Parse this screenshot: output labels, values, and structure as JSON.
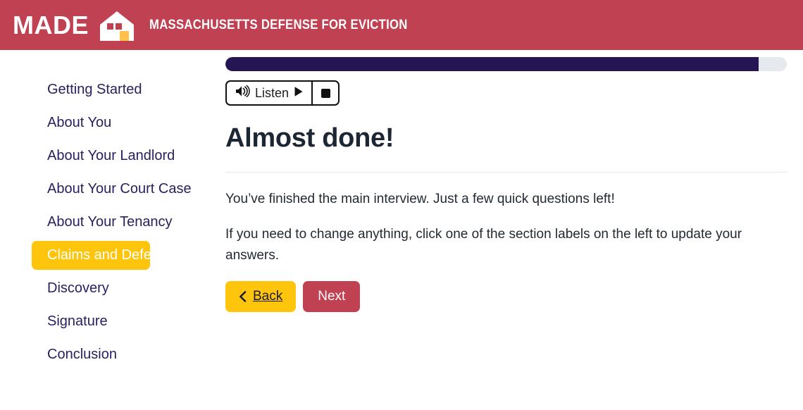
{
  "header": {
    "brand": "MADE",
    "tagline": "MASSACHUSETTS DEFENSE FOR EVICTION",
    "logo_icon": "house-icon",
    "bg_color": "#bf4152"
  },
  "sidebar": {
    "items": [
      {
        "label": "Getting Started",
        "active": false
      },
      {
        "label": "About You",
        "active": false
      },
      {
        "label": "About Your Landlord",
        "active": false
      },
      {
        "label": "About Your Court Case",
        "active": false
      },
      {
        "label": "About Your Tenancy",
        "active": false
      },
      {
        "label": "Claims and Defenses",
        "active": true
      },
      {
        "label": "Discovery",
        "active": false
      },
      {
        "label": "Signature",
        "active": false
      },
      {
        "label": "Conclusion",
        "active": false
      }
    ],
    "active_bg_color": "#ffc40c",
    "text_color": "#2a2060"
  },
  "progress": {
    "percent": 95,
    "fill_color": "#261553",
    "track_color": "#e6e9ed"
  },
  "audio": {
    "listen_label": "Listen",
    "speaker_icon": "speaker-volume-icon",
    "play_icon": "play-icon",
    "stop_icon": "stop-icon"
  },
  "main": {
    "title": "Almost done!",
    "paragraph_1": "You’ve finished the main interview. Just a few quick questions left!",
    "paragraph_2": "If you need to change anything, click one of the section labels on the left to update your answers."
  },
  "buttons": {
    "back_label": "Back",
    "back_icon": "chevron-left-icon",
    "back_color": "#ffc40c",
    "next_label": "Next",
    "next_color": "#bf4152"
  }
}
